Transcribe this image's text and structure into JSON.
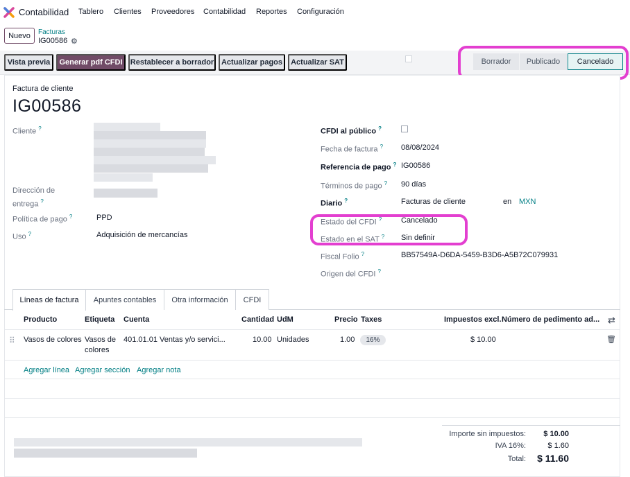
{
  "app": {
    "name": "Contabilidad"
  },
  "menu": [
    "Tablero",
    "Clientes",
    "Proveedores",
    "Contabilidad",
    "Reportes",
    "Configuración"
  ],
  "control": {
    "new_label": "Nuevo",
    "breadcrumb_parent": "Facturas",
    "breadcrumb_current": "IG00586"
  },
  "actions": [
    "Vista previa",
    "Generar pdf CFDI",
    "Restablecer a borrador",
    "Actualizar pagos",
    "Actualizar SAT"
  ],
  "status_steps": [
    "Borrador",
    "Publicado",
    "Cancelado"
  ],
  "status_active": "Cancelado",
  "form": {
    "doc_type": "Factura de cliente",
    "name": "IG00586",
    "left": {
      "cliente_label": "Cliente",
      "direccion_label": "Dirección de entrega",
      "politica_label": "Política de pago",
      "politica_value": "PPD",
      "uso_label": "Uso",
      "uso_value": "Adquisición de mercancías"
    },
    "right": {
      "cfdi_publico_label": "CFDI al público",
      "fecha_label": "Fecha de factura",
      "fecha_value": "08/08/2024",
      "referencia_label": "Referencia de pago",
      "referencia_value": "IG00586",
      "terminos_label": "Términos de pago",
      "terminos_value": "90 días",
      "diario_label": "Diario",
      "diario_value": "Facturas de cliente",
      "diario_en": "en",
      "diario_currency": "MXN",
      "estado_cfdi_label": "Estado del CFDI",
      "estado_cfdi_value": "Cancelado",
      "estado_sat_label": "Estado en el SAT",
      "estado_sat_value": "Sin definir",
      "folio_label": "Fiscal Folio",
      "folio_value": "BB57549A-D6DA-5459-B3D6-A5B72C079931",
      "origen_label": "Origen del CFDI"
    }
  },
  "tabs": [
    "Líneas de factura",
    "Apuntes contables",
    "Otra información",
    "CFDI"
  ],
  "table": {
    "headers": [
      "Producto",
      "Etiqueta",
      "Cuenta",
      "Cantidad",
      "UdM",
      "Precio",
      "Taxes",
      "Impuestos excl.",
      "Número de pedimento ad..."
    ],
    "rows": [
      {
        "producto": "Vasos de colores",
        "etiqueta_l1": "Vasos de",
        "etiqueta_l2": "colores",
        "cuenta": "401.01.01 Ventas y/o servici...",
        "cantidad": "10.00",
        "udm": "Unidades",
        "precio": "1.00",
        "taxes": "16%",
        "impuestos_excl": "$ 10.00"
      }
    ],
    "add_links": [
      "Agregar línea",
      "Agregar sección",
      "Agregar nota"
    ]
  },
  "totals": {
    "subtotal_label": "Importe sin impuestos:",
    "subtotal_value": "$ 10.00",
    "iva_label": "IVA 16%:",
    "iva_value": "$ 1.60",
    "total_label": "Total:",
    "total_value": "$ 11.60"
  },
  "colors": {
    "primary": "#714b67",
    "link": "#017e84",
    "highlight": "#e33fd0"
  }
}
